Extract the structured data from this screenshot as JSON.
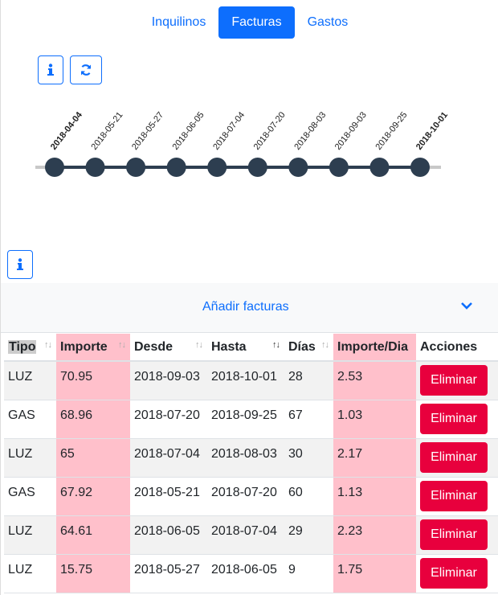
{
  "nav": {
    "tabs": [
      "Inquilinos",
      "Facturas",
      "Gastos"
    ],
    "active": "Facturas"
  },
  "toolbar": {
    "info_icon": "info-icon",
    "refresh_icon": "refresh-icon"
  },
  "timeline": {
    "dates": [
      "2018-04-04",
      "2018-05-21",
      "2018-05-27",
      "2018-06-05",
      "2018-07-04",
      "2018-07-20",
      "2018-08-03",
      "2018-09-03",
      "2018-09-25",
      "2018-10-01"
    ],
    "bold": [
      "2018-04-04",
      "2018-10-01"
    ],
    "colors": {
      "line": "#2d3e50",
      "dot": "#2d3e50",
      "track": "#c8c8c8"
    }
  },
  "collapse": {
    "title": "Añadir facturas",
    "icon": "chevron-down-icon"
  },
  "table": {
    "headers": [
      "Tipo",
      "Importe",
      "Desde",
      "Hasta",
      "Días",
      "Importe/Dia",
      "Acciones"
    ],
    "rows": [
      {
        "tipo": "LUZ",
        "importe": "70.95",
        "desde": "2018-09-03",
        "hasta": "2018-10-01",
        "dias": "28",
        "importe_dia": "2.53",
        "action": "Eliminar"
      },
      {
        "tipo": "GAS",
        "importe": "68.96",
        "desde": "2018-07-20",
        "hasta": "2018-09-25",
        "dias": "67",
        "importe_dia": "1.03",
        "action": "Eliminar"
      },
      {
        "tipo": "LUZ",
        "importe": "65",
        "desde": "2018-07-04",
        "hasta": "2018-08-03",
        "dias": "30",
        "importe_dia": "2.17",
        "action": "Eliminar"
      },
      {
        "tipo": "GAS",
        "importe": "67.92",
        "desde": "2018-05-21",
        "hasta": "2018-07-20",
        "dias": "60",
        "importe_dia": "1.13",
        "action": "Eliminar"
      },
      {
        "tipo": "LUZ",
        "importe": "64.61",
        "desde": "2018-06-05",
        "hasta": "2018-07-04",
        "dias": "29",
        "importe_dia": "2.23",
        "action": "Eliminar"
      },
      {
        "tipo": "LUZ",
        "importe": "15.75",
        "desde": "2018-05-27",
        "hasta": "2018-06-05",
        "dias": "9",
        "importe_dia": "1.75",
        "action": "Eliminar"
      }
    ]
  },
  "colors": {
    "accent": "#0d6efd",
    "highlight_column": "#ffc0cb",
    "danger": "#e8003d"
  }
}
